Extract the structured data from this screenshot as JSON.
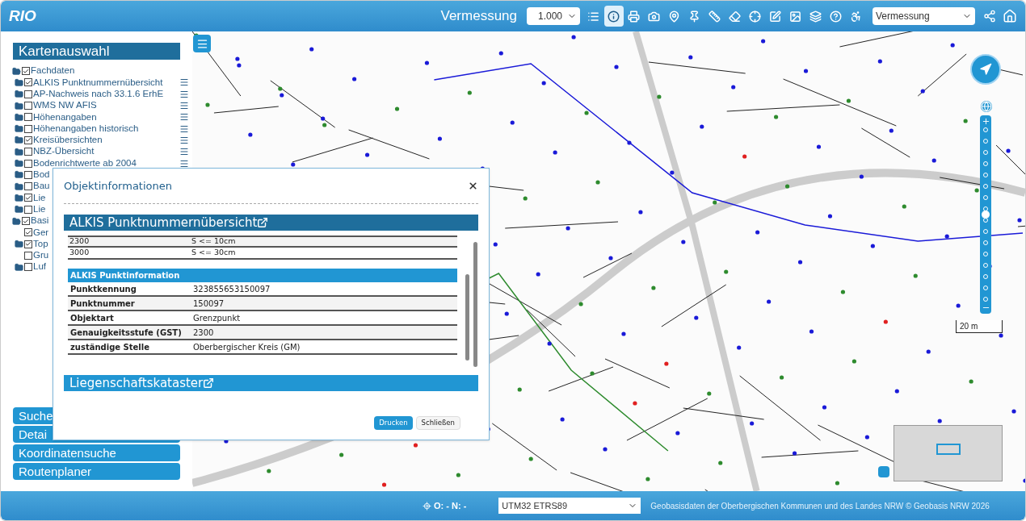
{
  "header": {
    "logo": "RIO",
    "title": "Vermessung",
    "scale_select": "1.000",
    "theme_select": "Vermessung",
    "tools": [
      {
        "kind": "list",
        "selected": false
      },
      {
        "kind": "info",
        "selected": true
      },
      {
        "kind": "print",
        "selected": false
      },
      {
        "kind": "camera",
        "selected": false
      },
      {
        "kind": "marker",
        "selected": false
      },
      {
        "kind": "pin",
        "selected": false
      },
      {
        "kind": "measure",
        "selected": false
      },
      {
        "kind": "area",
        "selected": false
      },
      {
        "kind": "locate",
        "selected": false
      },
      {
        "kind": "edit",
        "selected": false
      },
      {
        "kind": "image",
        "selected": false
      },
      {
        "kind": "layers",
        "selected": false
      },
      {
        "kind": "help",
        "selected": false
      },
      {
        "kind": "access",
        "selected": false
      }
    ]
  },
  "sidebar": {
    "title": "Kartenauswahl",
    "layers": [
      {
        "label": "Fachdaten",
        "kind": "folder",
        "checked": true,
        "expanded": true,
        "children": [
          {
            "label": "ALKIS Punktnummernübersicht",
            "kind": "folder",
            "checked": true
          },
          {
            "label": "AP-Nachweis nach 33.1.6 ErhE",
            "kind": "folder",
            "checked": false
          },
          {
            "label": "WMS NW AFIS",
            "kind": "folder",
            "checked": false
          },
          {
            "label": "Höhenangaben",
            "kind": "folder",
            "checked": false
          },
          {
            "label": "Höhenangaben historisch",
            "kind": "folder",
            "checked": false
          },
          {
            "label": "Kreisübersichten",
            "kind": "folder",
            "checked": true
          },
          {
            "label": "NBZ-Übersicht",
            "kind": "folder",
            "checked": false
          },
          {
            "label": "Bodenrichtwerte ab 2004",
            "kind": "folder",
            "checked": false
          },
          {
            "label": "Bod",
            "kind": "folder",
            "checked": false
          },
          {
            "label": "Bau",
            "kind": "folder",
            "checked": false
          },
          {
            "label": "Lie",
            "kind": "folder",
            "checked": true
          },
          {
            "label": "Lie",
            "kind": "folder",
            "checked": false
          }
        ]
      },
      {
        "label": "Basi",
        "kind": "folder",
        "checked": true,
        "expanded": true,
        "children": [
          {
            "label": "Ger",
            "kind": "layer",
            "checked": true
          },
          {
            "label": "Top",
            "kind": "folder",
            "checked": true
          },
          {
            "label": "Gru",
            "kind": "layer",
            "checked": false
          },
          {
            "label": "Luf",
            "kind": "folder",
            "checked": false
          }
        ]
      }
    ],
    "panels": [
      "Suche",
      "Detai",
      "Koordinatensuche",
      "Routenplaner"
    ]
  },
  "dialog": {
    "title": "Objektinformationen",
    "sections": [
      {
        "title": "ALKIS Punktnummernübersicht",
        "kind": "dark",
        "rows": [
          {
            "key": "2300",
            "value": "S <= 10cm"
          },
          {
            "key": "3000",
            "value": "S <= 30cm"
          }
        ],
        "subsection": {
          "title": "ALKIS Punktinformation",
          "rows": [
            {
              "key": "Punktkennung",
              "value": "323855653150097"
            },
            {
              "key": "Punktnummer",
              "value": "150097"
            },
            {
              "key": "Objektart",
              "value": "Grenzpunkt"
            },
            {
              "key": "Genauigkeitsstufe (GST)",
              "value": "2300"
            },
            {
              "key": "zuständige Stelle",
              "value": "Oberbergischer Kreis (GM)"
            }
          ]
        }
      },
      {
        "title": "Liegenschaftskataster",
        "kind": "light"
      }
    ],
    "buttons": [
      {
        "label": "Drucken",
        "kind": "primary"
      },
      {
        "label": "Schließen",
        "kind": "default"
      }
    ]
  },
  "map": {
    "scale_label": "20 m",
    "zoom": {
      "level": 0.5
    }
  },
  "footer": {
    "coordinates": "O: - N: -",
    "crs_select": "UTM32 ETRS89",
    "attribution": "Geobasisdaten der Oberbergischen Kommunen und des Landes NRW © Geobasis NRW 2026"
  }
}
